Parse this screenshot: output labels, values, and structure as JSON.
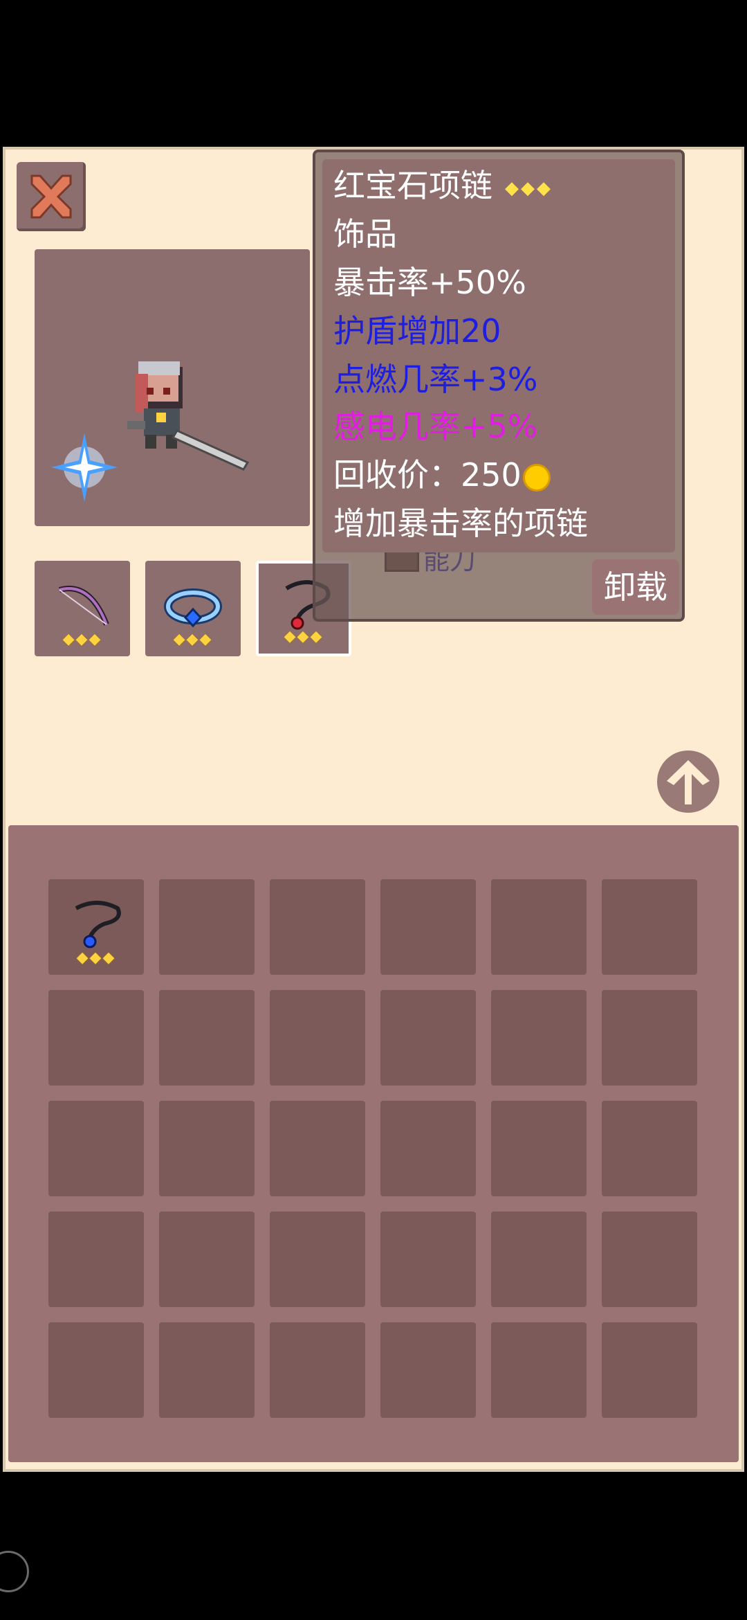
{
  "item": {
    "name": "红宝石项链",
    "stars": "◆◆◆",
    "category": "饰品",
    "stat_crit": "暴击率+50%",
    "stat_shield": "护盾增加20",
    "stat_ignite": "点燃几率+3%",
    "stat_shock": "感电几率+5%",
    "sell_label": "回收价：",
    "sell_value": "250",
    "description": "增加暴击率的项链",
    "colors": {
      "white": "#ffffff",
      "blue": "#1e1ee0",
      "magenta": "#e01ee0"
    }
  },
  "actions": {
    "unequip_label": "卸载"
  },
  "background_text": {
    "partial_label": "能刀"
  },
  "equipped": [
    {
      "icon": "bow-icon",
      "stars": "◆◆◆"
    },
    {
      "icon": "ring-icon",
      "stars": "◆◆◆"
    },
    {
      "icon": "necklace-icon",
      "stars": "◆◆◆",
      "selected": true
    }
  ],
  "inventory": {
    "rows": 5,
    "cols": 6,
    "items": [
      {
        "slot": 0,
        "icon": "necklace-icon",
        "stars": "◆◆◆"
      }
    ]
  },
  "icons": {
    "close": "close-icon",
    "upload": "arrow-up-icon",
    "coin": "coin-icon",
    "hero": "hero-sprite",
    "sparkle": "sparkle-icon"
  }
}
